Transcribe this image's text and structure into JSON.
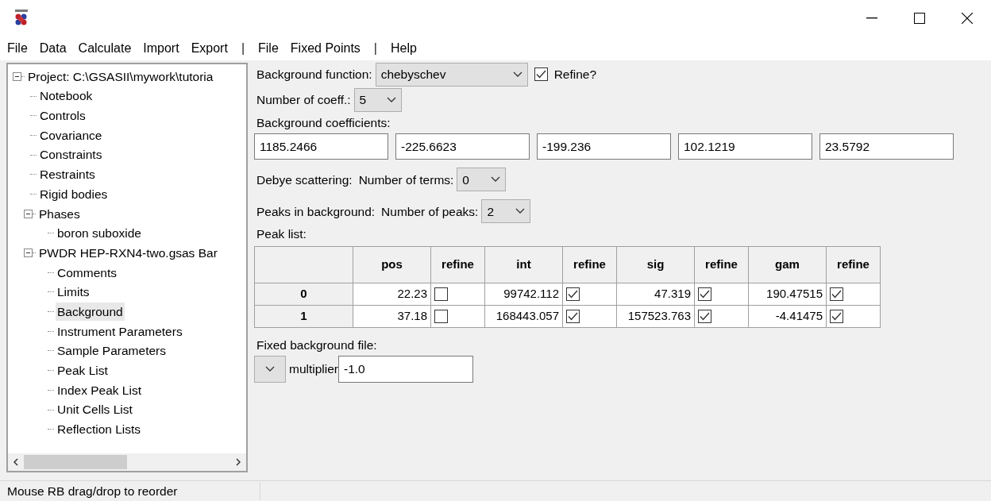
{
  "menu": [
    {
      "kind": "item",
      "text": "File"
    },
    {
      "kind": "item",
      "text": "Data"
    },
    {
      "kind": "item",
      "text": "Calculate"
    },
    {
      "kind": "item",
      "text": "Import"
    },
    {
      "kind": "item",
      "text": "Export"
    },
    {
      "kind": "divider",
      "text": "|"
    },
    {
      "kind": "item",
      "text": "File"
    },
    {
      "kind": "item",
      "text": "Fixed Points"
    },
    {
      "kind": "divider",
      "text": "|"
    },
    {
      "kind": "item",
      "text": "Help"
    }
  ],
  "tree": [
    {
      "label": "Project: C:\\GSASII\\mywork\\tutoria",
      "expanded": true,
      "selected": false,
      "children": [
        {
          "label": "Notebook",
          "selected": false
        },
        {
          "label": "Controls",
          "selected": false
        },
        {
          "label": "Covariance",
          "selected": false
        },
        {
          "label": "Constraints",
          "selected": false
        },
        {
          "label": "Restraints",
          "selected": false
        },
        {
          "label": "Rigid bodies",
          "selected": false
        },
        {
          "label": "Phases",
          "expanded": true,
          "selected": false,
          "children": [
            {
              "label": "boron suboxide",
              "selected": false
            }
          ]
        },
        {
          "label": "PWDR HEP-RXN4-two.gsas Bar",
          "expanded": true,
          "selected": false,
          "children": [
            {
              "label": "Comments",
              "selected": false
            },
            {
              "label": "Limits",
              "selected": false
            },
            {
              "label": "Background",
              "selected": true
            },
            {
              "label": "Instrument Parameters",
              "selected": false
            },
            {
              "label": "Sample Parameters",
              "selected": false
            },
            {
              "label": "Peak List",
              "selected": false
            },
            {
              "label": "Index Peak List",
              "selected": false
            },
            {
              "label": "Unit Cells List",
              "selected": false
            },
            {
              "label": "Reflection Lists",
              "selected": false
            }
          ]
        }
      ]
    }
  ],
  "background": {
    "function_label": "Background function:",
    "function_value": "chebyschev",
    "refine_label": "Refine?",
    "refine_checked": true,
    "coeff_label": "Number of coeff.:",
    "coeff_value": "5",
    "coefficients_label": "Background coefficients:",
    "coefficients": [
      "1185.2466",
      "-225.6623",
      "-199.236",
      "102.1219",
      "23.5792"
    ],
    "debye_label": "Debye scattering:",
    "debye_terms_label": "Number of terms:",
    "debye_terms_value": "0",
    "peaks_label": "Peaks in background:",
    "peaks_count_label": "Number of peaks:",
    "peaks_count_value": "2",
    "peak_list_label": "Peak list:"
  },
  "peak_table": {
    "columns": [
      "pos",
      "refine",
      "int",
      "refine",
      "sig",
      "refine",
      "gam",
      "refine"
    ],
    "rows": [
      {
        "label": "0",
        "cells": [
          {
            "kind": "value",
            "text": "22.23"
          },
          {
            "kind": "check",
            "checked": false
          },
          {
            "kind": "value",
            "text": "99742.112"
          },
          {
            "kind": "check",
            "checked": true
          },
          {
            "kind": "value",
            "text": "47.319"
          },
          {
            "kind": "check",
            "checked": true
          },
          {
            "kind": "value",
            "text": "190.47515"
          },
          {
            "kind": "check",
            "checked": true
          }
        ]
      },
      {
        "label": "1",
        "cells": [
          {
            "kind": "value",
            "text": "37.18"
          },
          {
            "kind": "check",
            "checked": false
          },
          {
            "kind": "value",
            "text": "168443.057"
          },
          {
            "kind": "check",
            "checked": true
          },
          {
            "kind": "value",
            "text": "157523.763"
          },
          {
            "kind": "check",
            "checked": true
          },
          {
            "kind": "value",
            "text": "-4.41475"
          },
          {
            "kind": "check",
            "checked": true
          }
        ]
      }
    ]
  },
  "fixed_background": {
    "label": "Fixed background file:",
    "multiplier_label": "multiplier",
    "multiplier_value": "-1.0"
  },
  "status_bar": {
    "text": "Mouse RB drag/drop to reorder"
  }
}
